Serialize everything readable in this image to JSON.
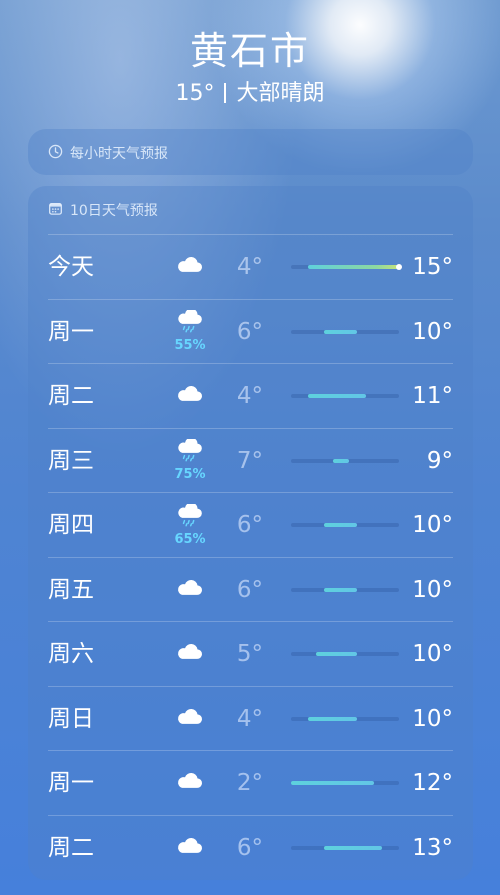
{
  "header": {
    "city": "黄石市",
    "current_temp": "15°",
    "condition": "大部晴朗"
  },
  "hourly": {
    "title": "每小时天气预报",
    "icon": "clock-icon"
  },
  "daily": {
    "title": "10日天气预报",
    "icon": "calendar-icon",
    "range_min": 2,
    "range_max": 15,
    "current_temp_value": 15,
    "days": [
      {
        "day": "今天",
        "icon": "cloud-icon",
        "precip": "",
        "low": "4°",
        "high": "15°",
        "low_v": 4,
        "high_v": 15,
        "current": true
      },
      {
        "day": "周一",
        "icon": "rain-icon",
        "precip": "55%",
        "low": "6°",
        "high": "10°",
        "low_v": 6,
        "high_v": 10
      },
      {
        "day": "周二",
        "icon": "cloud-icon",
        "precip": "",
        "low": "4°",
        "high": "11°",
        "low_v": 4,
        "high_v": 11
      },
      {
        "day": "周三",
        "icon": "rain-icon",
        "precip": "75%",
        "low": "7°",
        "high": "9°",
        "low_v": 7,
        "high_v": 9
      },
      {
        "day": "周四",
        "icon": "rain-icon",
        "precip": "65%",
        "low": "6°",
        "high": "10°",
        "low_v": 6,
        "high_v": 10
      },
      {
        "day": "周五",
        "icon": "cloud-icon",
        "precip": "",
        "low": "6°",
        "high": "10°",
        "low_v": 6,
        "high_v": 10
      },
      {
        "day": "周六",
        "icon": "cloud-icon",
        "precip": "",
        "low": "5°",
        "high": "10°",
        "low_v": 5,
        "high_v": 10
      },
      {
        "day": "周日",
        "icon": "cloud-icon",
        "precip": "",
        "low": "4°",
        "high": "10°",
        "low_v": 4,
        "high_v": 10
      },
      {
        "day": "周一",
        "icon": "cloud-icon",
        "precip": "",
        "low": "2°",
        "high": "12°",
        "low_v": 2,
        "high_v": 12
      },
      {
        "day": "周二",
        "icon": "cloud-icon",
        "precip": "",
        "low": "6°",
        "high": "13°",
        "low_v": 6,
        "high_v": 13
      }
    ]
  }
}
